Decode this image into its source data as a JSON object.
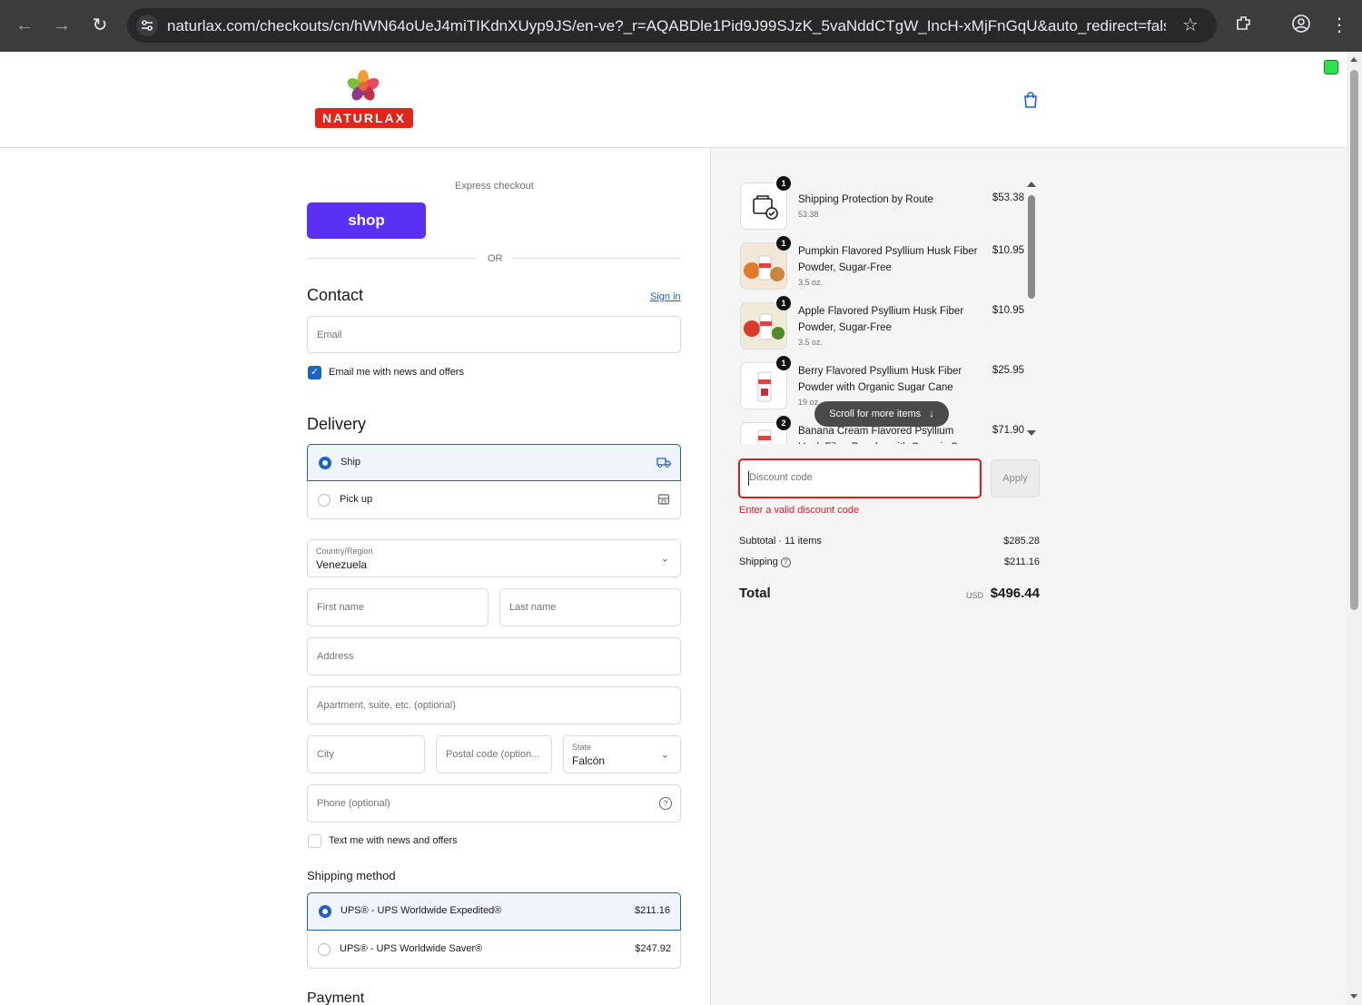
{
  "browser": {
    "url": "naturlax.com/checkouts/cn/hWN64oUeJ4miTIKdnXUyp9JS/en-ve?_r=AQABDle1Pid9J99SJzK_5vaNddCTgW_IncH-xMjFnGqU&auto_redirect=false&edg..."
  },
  "brand": {
    "name": "NATURLAX"
  },
  "express": {
    "label": "Express checkout",
    "shop_label": "shop",
    "or_label": "OR"
  },
  "contact": {
    "title": "Contact",
    "sign_in": "Sign in",
    "email_placeholder": "Email",
    "news_label": "Email me with news and offers"
  },
  "delivery": {
    "title": "Delivery",
    "ship": "Ship",
    "pickup": "Pick up",
    "country_label": "Country/Region",
    "country_value": "Venezuela",
    "first_name": "First name",
    "last_name": "Last name",
    "address": "Address",
    "apartment": "Apartment, suite, etc. (optional)",
    "city": "City",
    "postal": "Postal code (option...",
    "state_label": "State",
    "state_value": "Falcón",
    "phone": "Phone (optional)",
    "text_label": "Text me with news and offers"
  },
  "shipping_method": {
    "title": "Shipping method",
    "options": [
      {
        "name": "UPS® - UPS Worldwide Expedited®",
        "price": "$211.16"
      },
      {
        "name": "UPS® - UPS Worldwide Saver®",
        "price": "$247.92"
      }
    ]
  },
  "payment": {
    "title": "Payment"
  },
  "items": [
    {
      "qty": "1",
      "name": "Shipping Protection by Route",
      "sub": "53.38",
      "price": "$53.38"
    },
    {
      "qty": "1",
      "name": "Pumpkin Flavored Psyllium Husk Fiber Powder, Sugar-Free",
      "sub": "3.5 oz.",
      "price": "$10.95"
    },
    {
      "qty": "1",
      "name": "Apple Flavored Psyllium Husk Fiber Powder, Sugar-Free",
      "sub": "3.5 oz.",
      "price": "$10.95"
    },
    {
      "qty": "1",
      "name": "Berry Flavored Psyllium Husk Fiber Powder with Organic Sugar Cane",
      "sub": "19 oz.",
      "price": "$25.95"
    },
    {
      "qty": "2",
      "name": "Banana Cream Flavored Psyllium Husk Fiber Powder with Organic Sugar C...",
      "sub": "",
      "price": "$71.90"
    }
  ],
  "scroll_hint": "Scroll for more items",
  "discount": {
    "placeholder": "Discount code",
    "apply": "Apply",
    "error": "Enter a valid discount code"
  },
  "summary": {
    "subtotal_label": "Subtotal · 11 items",
    "subtotal": "$285.28",
    "shipping_label": "Shipping",
    "shipping": "$211.16",
    "total_label": "Total",
    "currency": "USD",
    "total": "$496.44"
  },
  "colors": {
    "accent": "#1f62c7",
    "shop": "#5a31f4",
    "error": "#dd1d1d",
    "brand_red": "#e1251b"
  }
}
